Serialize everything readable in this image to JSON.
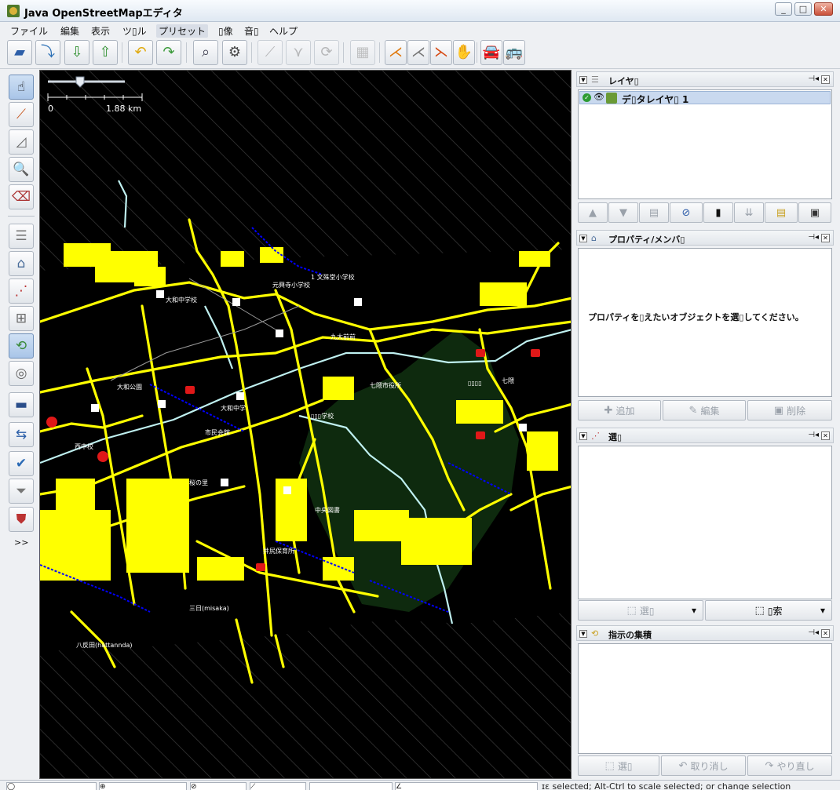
{
  "window": {
    "title": "Java OpenStreetMapエディタ",
    "buttons": [
      "_",
      "□",
      "✕"
    ]
  },
  "menu": [
    "ファイル",
    "編集",
    "表示",
    "ツ▯ル",
    "プリセット",
    "▯像",
    "音▯",
    "ヘルプ"
  ],
  "map": {
    "scale_zero": "0",
    "scale_distance": "1.88 km",
    "labels": [
      {
        "text": "1 文殊堂小学校"
      },
      {
        "text": "元興寺小学校"
      },
      {
        "text": "大和中学校"
      },
      {
        "text": "九大前前"
      },
      {
        "text": "七隈市役所"
      },
      {
        "text": "桜の里"
      },
      {
        "text": "西中校"
      },
      {
        "text": "井尻保育所"
      },
      {
        "text": "三日(misaka)"
      },
      {
        "text": "八反田(hattannda)"
      },
      {
        "text": "中央図書"
      },
      {
        "text": "大和中学"
      },
      {
        "text": "▯▯▯学校"
      },
      {
        "text": "市民会館"
      },
      {
        "text": "大和公園"
      },
      {
        "text": "▯▯▯▯"
      },
      {
        "text": "七隈"
      }
    ]
  },
  "panels": {
    "layers": {
      "title": "レイヤ▯",
      "layer_name": "デ▯タレイヤ▯ 1"
    },
    "properties": {
      "title": "プロパティ/メンバ▯",
      "hint": "プロパティを▯えたいオブジェクトを選▯してください。",
      "add": "追加",
      "edit": "編集",
      "delete": "削除"
    },
    "selection": {
      "title": "選▯",
      "select": "選▯",
      "search": "▯索"
    },
    "command_stack": {
      "title": "指示の集積",
      "select": "選▯",
      "undo": "取り消し",
      "redo": "やり直し"
    }
  },
  "palette": {
    "more": ">>"
  },
  "status": {
    "message": "ɪɛ selected; Alt-Ctrl to scale selected; or change selection"
  },
  "colors": {
    "road": "#ffff00",
    "path": "#0000ff",
    "water": "#bff0f0",
    "forest": "#0e2a0e",
    "hatch": "#3a3a3a"
  }
}
